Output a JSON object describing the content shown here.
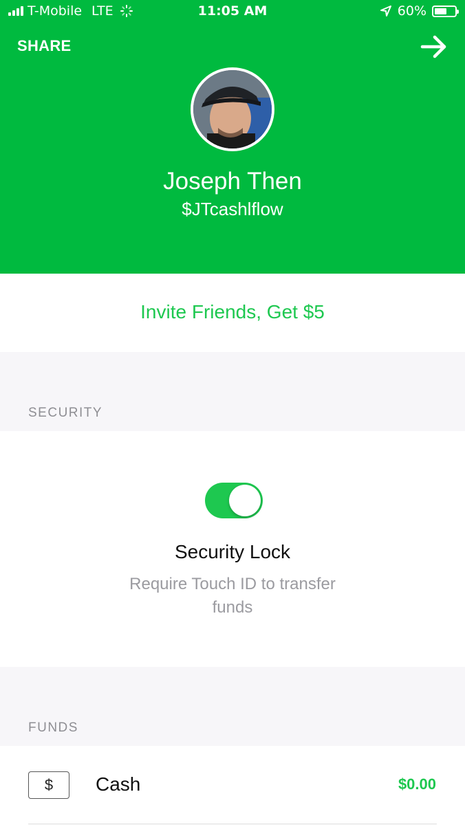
{
  "status_bar": {
    "carrier": "T-Mobile",
    "network": "LTE",
    "time": "11:05 AM",
    "battery_percent": "60%",
    "battery_level": 0.6,
    "icons": [
      "signal-icon",
      "loading-spinner-icon",
      "location-arrow-icon",
      "battery-icon"
    ]
  },
  "header": {
    "share_label": "SHARE",
    "arrow_icon": "arrow-right-icon",
    "name": "Joseph Then",
    "cashtag": "$JTcashlflow",
    "background_color": "#00ba3f"
  },
  "invite": {
    "label": "Invite Friends, Get $5"
  },
  "security": {
    "section_label": "SECURITY",
    "lock_title": "Security Lock",
    "lock_description": "Require Touch ID to transfer funds",
    "toggle_on": true
  },
  "funds": {
    "section_label": "FUNDS",
    "cash_icon_symbol": "$",
    "cash_label": "Cash",
    "cash_amount": "$0.00",
    "accent_color": "#1ec850"
  }
}
